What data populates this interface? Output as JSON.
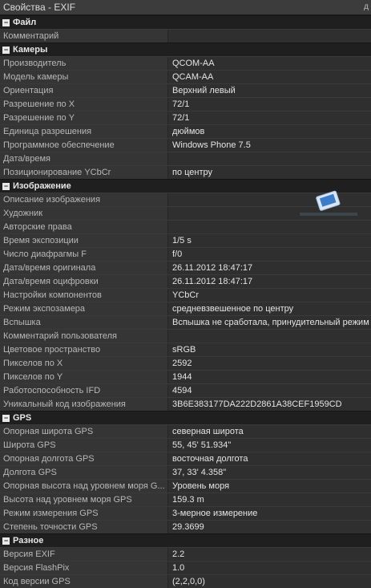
{
  "window": {
    "title": "Свойства - EXIF",
    "pin_glyph": "д"
  },
  "sections": [
    {
      "name": "Файл",
      "rows": [
        {
          "k": "Комментарий",
          "v": ""
        }
      ]
    },
    {
      "name": "Камеры",
      "rows": [
        {
          "k": "Производитель",
          "v": "QCOM-AA"
        },
        {
          "k": "Модель камеры",
          "v": "QCAM-AA"
        },
        {
          "k": "Ориентация",
          "v": "Верхний левый"
        },
        {
          "k": "Разрешение по X",
          "v": "72/1"
        },
        {
          "k": "Разрешение по Y",
          "v": "72/1"
        },
        {
          "k": "Единица разрешения",
          "v": "дюймов"
        },
        {
          "k": "Программное обеспечение",
          "v": "Windows Phone 7.5"
        },
        {
          "k": "Дата/время",
          "v": ""
        },
        {
          "k": "Позиционирование YCbCr",
          "v": "по центру"
        }
      ]
    },
    {
      "name": "Изображение",
      "rows": [
        {
          "k": "Описание изображения",
          "v": ""
        },
        {
          "k": "Художник",
          "v": ""
        },
        {
          "k": "Авторские права",
          "v": ""
        },
        {
          "k": "Время экспозиции",
          "v": "1/5 s"
        },
        {
          "k": "Число диафрагмы F",
          "v": "f/0"
        },
        {
          "k": "Дата/время оригинала",
          "v": "26.11.2012 18:47:17"
        },
        {
          "k": "Дата/время оцифровки",
          "v": "26.11.2012 18:47:17"
        },
        {
          "k": "Настройки компонентов",
          "v": "YCbCr"
        },
        {
          "k": "Режим экспозамера",
          "v": "средневзвешенное по центру"
        },
        {
          "k": "Вспышка",
          "v": "Вспышка не сработала, принудительный режим"
        },
        {
          "k": "Комментарий пользователя",
          "v": ""
        },
        {
          "k": "Цветовое пространство",
          "v": "sRGB"
        },
        {
          "k": "Пикселов по X",
          "v": "2592"
        },
        {
          "k": "Пикселов по Y",
          "v": "1944"
        },
        {
          "k": "Работоспособность IFD",
          "v": "4594"
        },
        {
          "k": "Уникальный код изображения",
          "v": "3B6E383177DA222D2861A38CEF1959CD"
        }
      ]
    },
    {
      "name": "GPS",
      "rows": [
        {
          "k": "Опорная широта GPS",
          "v": "северная широта"
        },
        {
          "k": "Широта GPS",
          "v": "55, 45' 51.934\""
        },
        {
          "k": "Опорная долгота GPS",
          "v": "восточная долгота"
        },
        {
          "k": "Долгота GPS",
          "v": "37, 33' 4.358\""
        },
        {
          "k": "Опорная высота над уровнем моря G...",
          "v": "Уровень моря"
        },
        {
          "k": "Высота над уровнем моря GPS",
          "v": "159.3 m"
        },
        {
          "k": "Режим измерения GPS",
          "v": "3-мерное измерение"
        },
        {
          "k": "Степень точности GPS",
          "v": "29.3699"
        }
      ]
    },
    {
      "name": "Разное",
      "rows": [
        {
          "k": "Версия EXIF",
          "v": "2.2"
        },
        {
          "k": "Версия FlashPix",
          "v": "1.0"
        },
        {
          "k": "Код версии GPS",
          "v": "(2,2,0,0)"
        }
      ]
    }
  ],
  "colors": {
    "section_bg": "#1f1f1f",
    "key_bg": "#353535",
    "value_bg": "#2f2f2f"
  },
  "icons": {
    "collapse": "minus-box-icon"
  }
}
